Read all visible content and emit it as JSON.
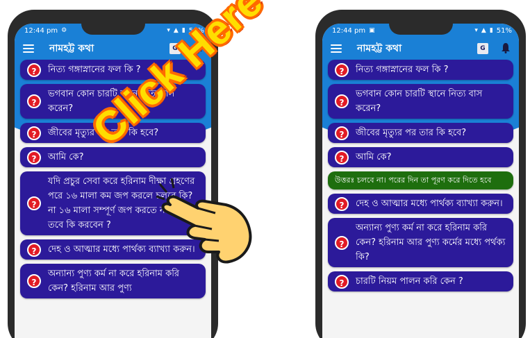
{
  "overlay": {
    "text": "Click Here"
  },
  "left_phone": {
    "status": {
      "time": "12:44 pm",
      "battery": "50%"
    },
    "app_title": "নামহট্ট কথা",
    "cards": [
      {
        "text": "নিত্য গঙ্গাস্নানের ফল কি ?"
      },
      {
        "text": "ভগবান কোন চারটি স্থানে নিত্য বাস করেন?"
      },
      {
        "text": "জীবের মৃত্যুর পর তার কি হবে?"
      },
      {
        "text": "আমি কে?"
      },
      {
        "text": "যদি প্রচুর সেবা করে হরিনাম দীক্ষা গ্রহণের পরে ১৬ মালা কম জপ করলে চলবে কি? না ১৬ মালা সম্পূর্ণ জপ করতে না পারেন, তবে কি করবেন ?"
      },
      {
        "text": " দেহ ও আত্মার মধ্যে পার্থক্য ব্যাখ্যা করুন।"
      },
      {
        "text": "অন্যান্য পুণ্য কর্ম না করে হরিনাম করি কেন? হরিনাম আর পুণ্য"
      }
    ]
  },
  "right_phone": {
    "status": {
      "time": "12:44 pm",
      "battery": "51%"
    },
    "app_title": "নামহট্ট কথা",
    "cards": [
      {
        "text": "নিত্য গঙ্গাস্নানের ফল কি ?",
        "type": "question"
      },
      {
        "text": "ভগবান কোন চারটি স্থানে নিত্য বাস করেন?",
        "type": "question"
      },
      {
        "text": "জীবের মৃত্যুর পর তার কি হবে?",
        "type": "question"
      },
      {
        "text": "আমি কে?",
        "type": "question"
      },
      {
        "text": "উত্তরঃ চলবে না। পরের দিন তা পূরণ করে দিতে হবে",
        "type": "answer"
      },
      {
        "text": " দেহ ও আত্মার মধ্যে পার্থক্য ব্যাখ্যা করুন।",
        "type": "question"
      },
      {
        "text": "অন্যান্য পুণ্য কর্ম না করে হরিনাম করি কেন? হরিনাম আর পুণ্য কর্মের মধ্যে পর্থক্য কি?",
        "type": "question"
      },
      {
        "text": "চারটি নিয়ম পালন করি কেন ?",
        "type": "question"
      }
    ]
  },
  "colors": {
    "appbar": "#1a80d6",
    "card": "#2c1a9a",
    "answer_card": "#1e6e0e",
    "qmark": "#e21b25"
  },
  "icons": [
    "menu-icon",
    "translate-icon",
    "bell-icon",
    "question-icon",
    "pointing-hand-icon"
  ]
}
